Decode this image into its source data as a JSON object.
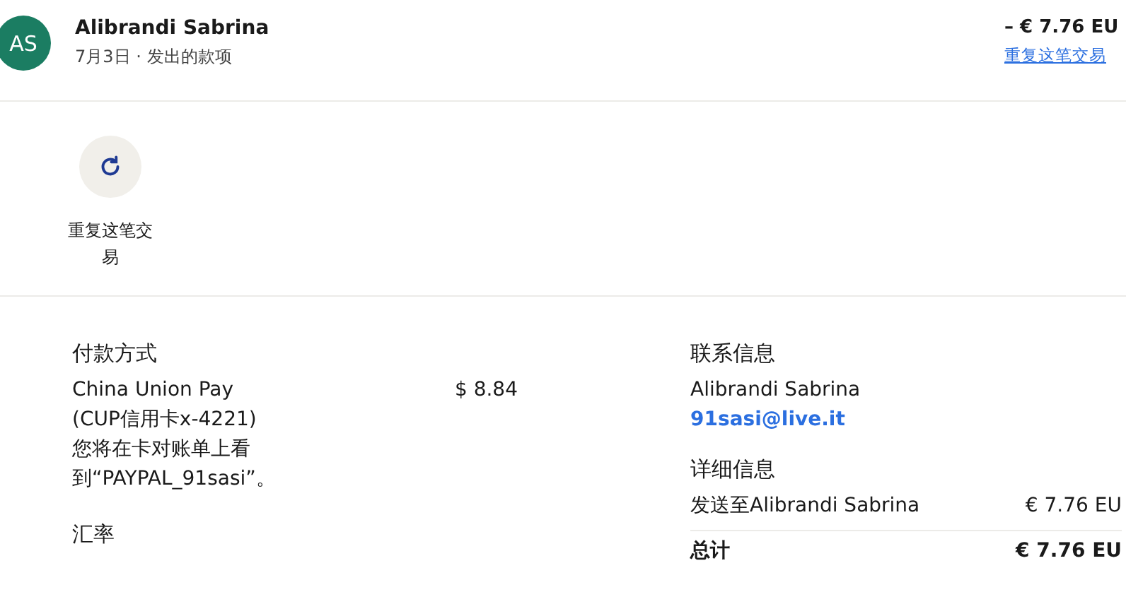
{
  "header": {
    "avatar": "AS",
    "name": "Alibrandi Sabrina",
    "date": "7月3日",
    "separator": "·",
    "type": "发出的款项",
    "amount": "– € 7.76 EU",
    "repeat_link": "重复这笔交易"
  },
  "actions": [
    {
      "label": "重复这笔交易"
    }
  ],
  "payment": {
    "title": "付款方式",
    "method": "China Union Pay",
    "card": "(CUP信用卡x-4221)",
    "note": "您将在卡对账单上看到“PAYPAL_91sasi”。",
    "amount": "$ 8.84",
    "next_title": "汇率"
  },
  "contact": {
    "title": "联系信息",
    "name": "Alibrandi Sabrina",
    "email": "91sasi@live.it"
  },
  "details": {
    "title": "详细信息",
    "rows": [
      {
        "label": "发送至Alibrandi Sabrina",
        "amount": "€ 7.76 EU"
      }
    ],
    "total_label": "总计",
    "total_amount": "€ 7.76 EU"
  }
}
